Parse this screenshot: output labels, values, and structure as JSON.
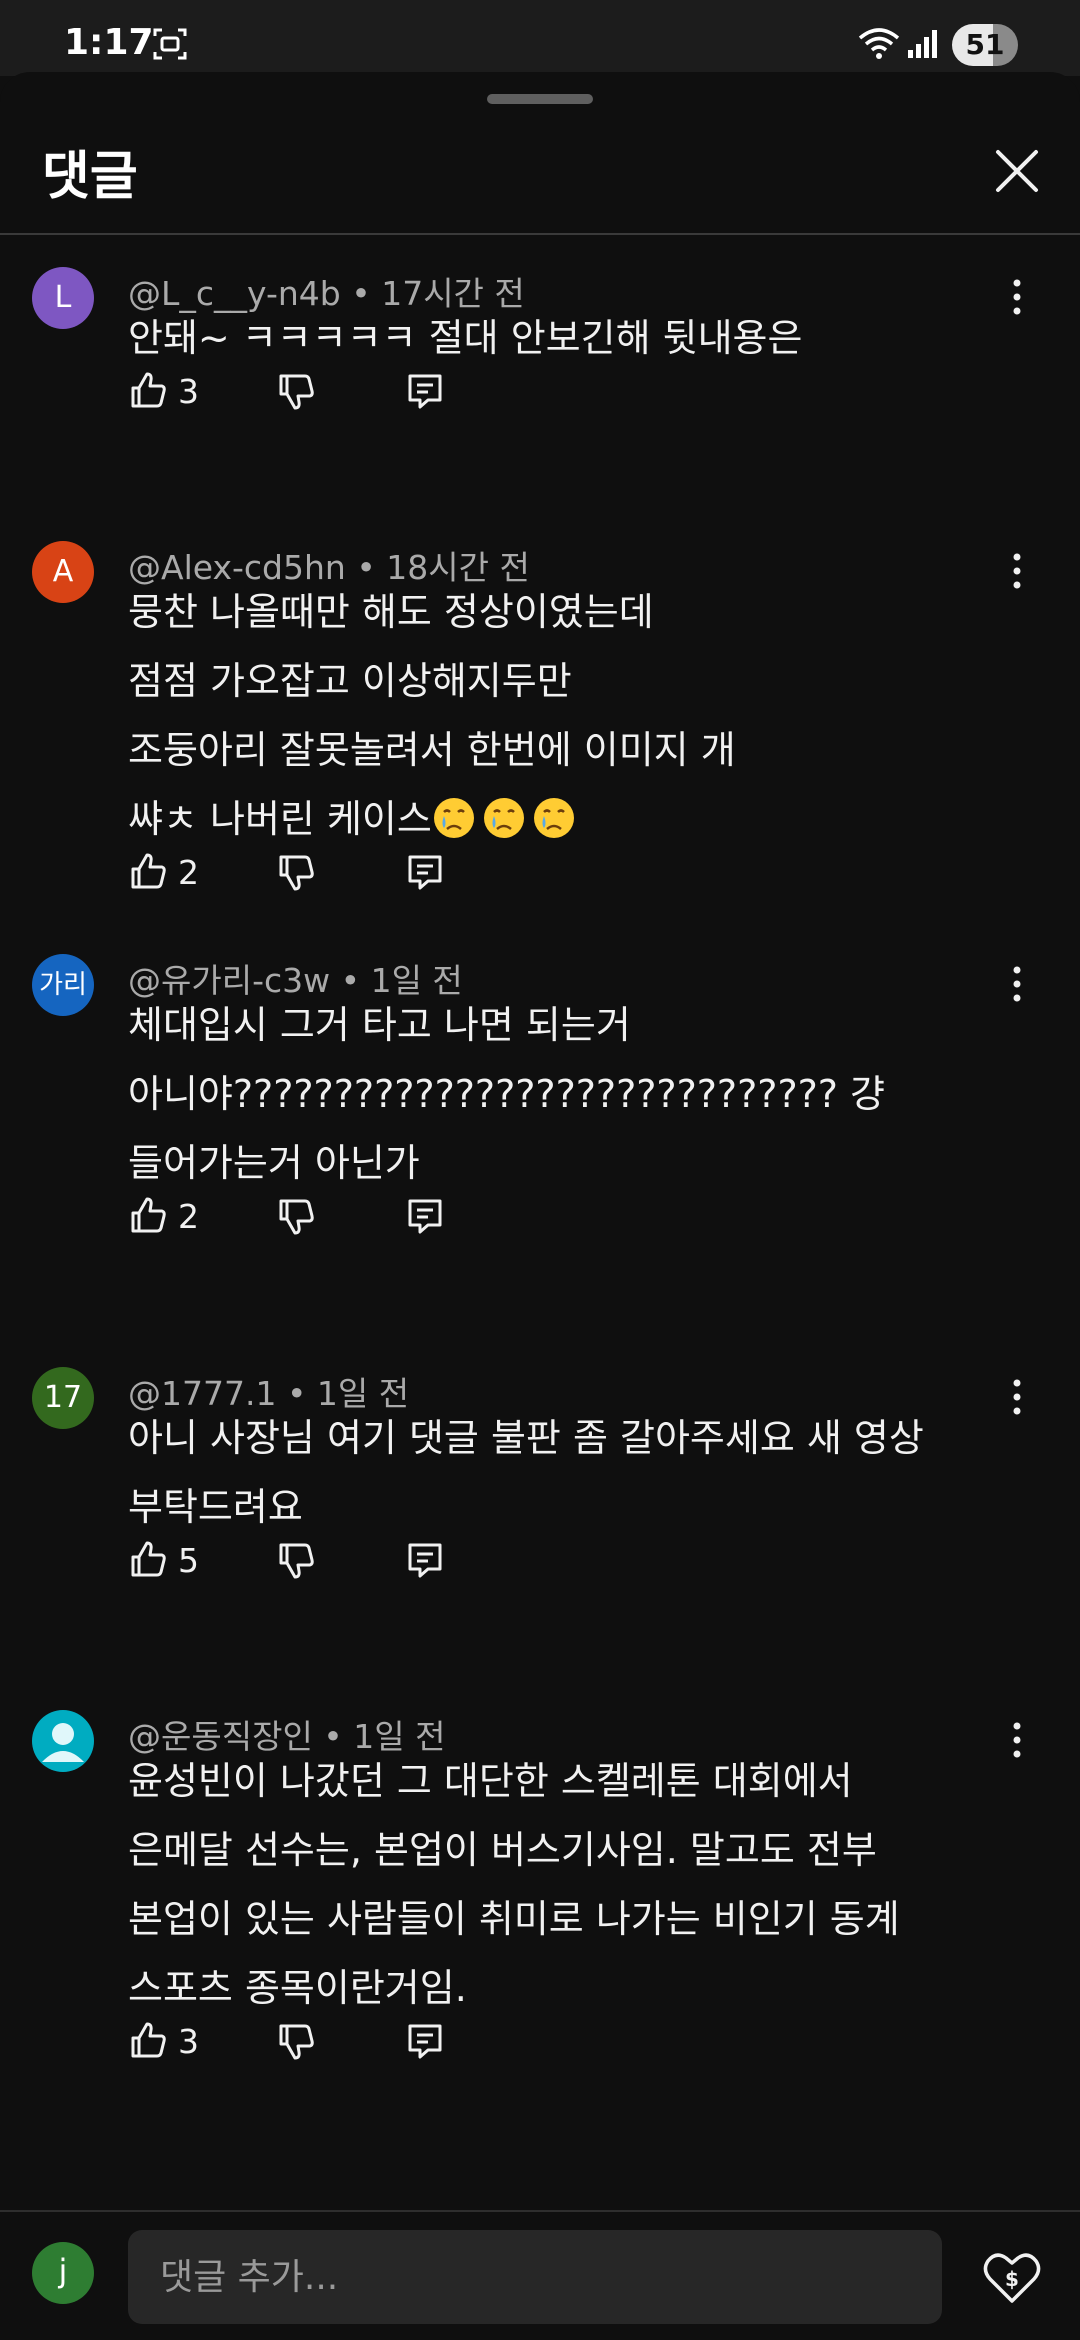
{
  "status_bar": {
    "time": "1:17",
    "battery": "51"
  },
  "sheet": {
    "title": "댓글"
  },
  "comments": [
    {
      "avatar_text": "L",
      "avatar_color": "#7e57c2",
      "author": "@L_c__y-n4b",
      "time": "17시간 전",
      "lines": [
        "안돼~ ㅋㅋㅋㅋㅋ 절대 안보긴해 뒷내용은"
      ],
      "likes": "3"
    },
    {
      "avatar_text": "A",
      "avatar_color": "#d84315",
      "author": "@Alex-cd5hn",
      "time": "18시간 전",
      "lines": [
        "뭉찬 나올때만 해도 정상이였는데",
        "점점 가오잡고 이상해지두만",
        "조둥아리 잘못놀려서 한번에 이미지 개",
        "쌰ㅊ 나버린 케이스"
      ],
      "emojis": [
        "crying-face",
        "crying-face",
        "crying-face"
      ],
      "likes": "2"
    },
    {
      "avatar_text": "가리",
      "avatar_color": "#1565c0",
      "author": "@유가리-c3w",
      "time": "1일 전",
      "lines": [
        "체대입시 그거 타고 나면 되는거",
        "아니야?????????????????????????????? 걍",
        "들어가는거 아닌가"
      ],
      "likes": "2"
    },
    {
      "avatar_text": "17",
      "avatar_color": "#33691e",
      "author": "@1777.1",
      "time": "1일 전",
      "lines": [
        "아니 사장님 여기 댓글 불판 좀 갈아주세요 새 영상",
        "부탁드려요"
      ],
      "likes": "5"
    },
    {
      "avatar_text": "",
      "avatar_color": "#00acc1",
      "author": "@운동직장인",
      "time": "1일 전",
      "lines": [
        "윤성빈이 나갔던 그 대단한 스켈레톤 대회에서",
        "은메달 선수는, 본업이 버스기사임. 말고도 전부",
        "본업이 있는 사람들이 취미로 나가는 비인기 동계",
        "스포츠 종목이란거임."
      ],
      "likes": "3"
    }
  ],
  "composer": {
    "avatar_text": "j",
    "placeholder": "댓글 추가..."
  },
  "icons": {
    "like": "thumbs-up-icon",
    "dislike": "thumbs-down-icon",
    "reply": "reply-icon",
    "more": "more-vert-icon",
    "close": "close-icon",
    "thanks": "super-thanks-heart-icon"
  }
}
